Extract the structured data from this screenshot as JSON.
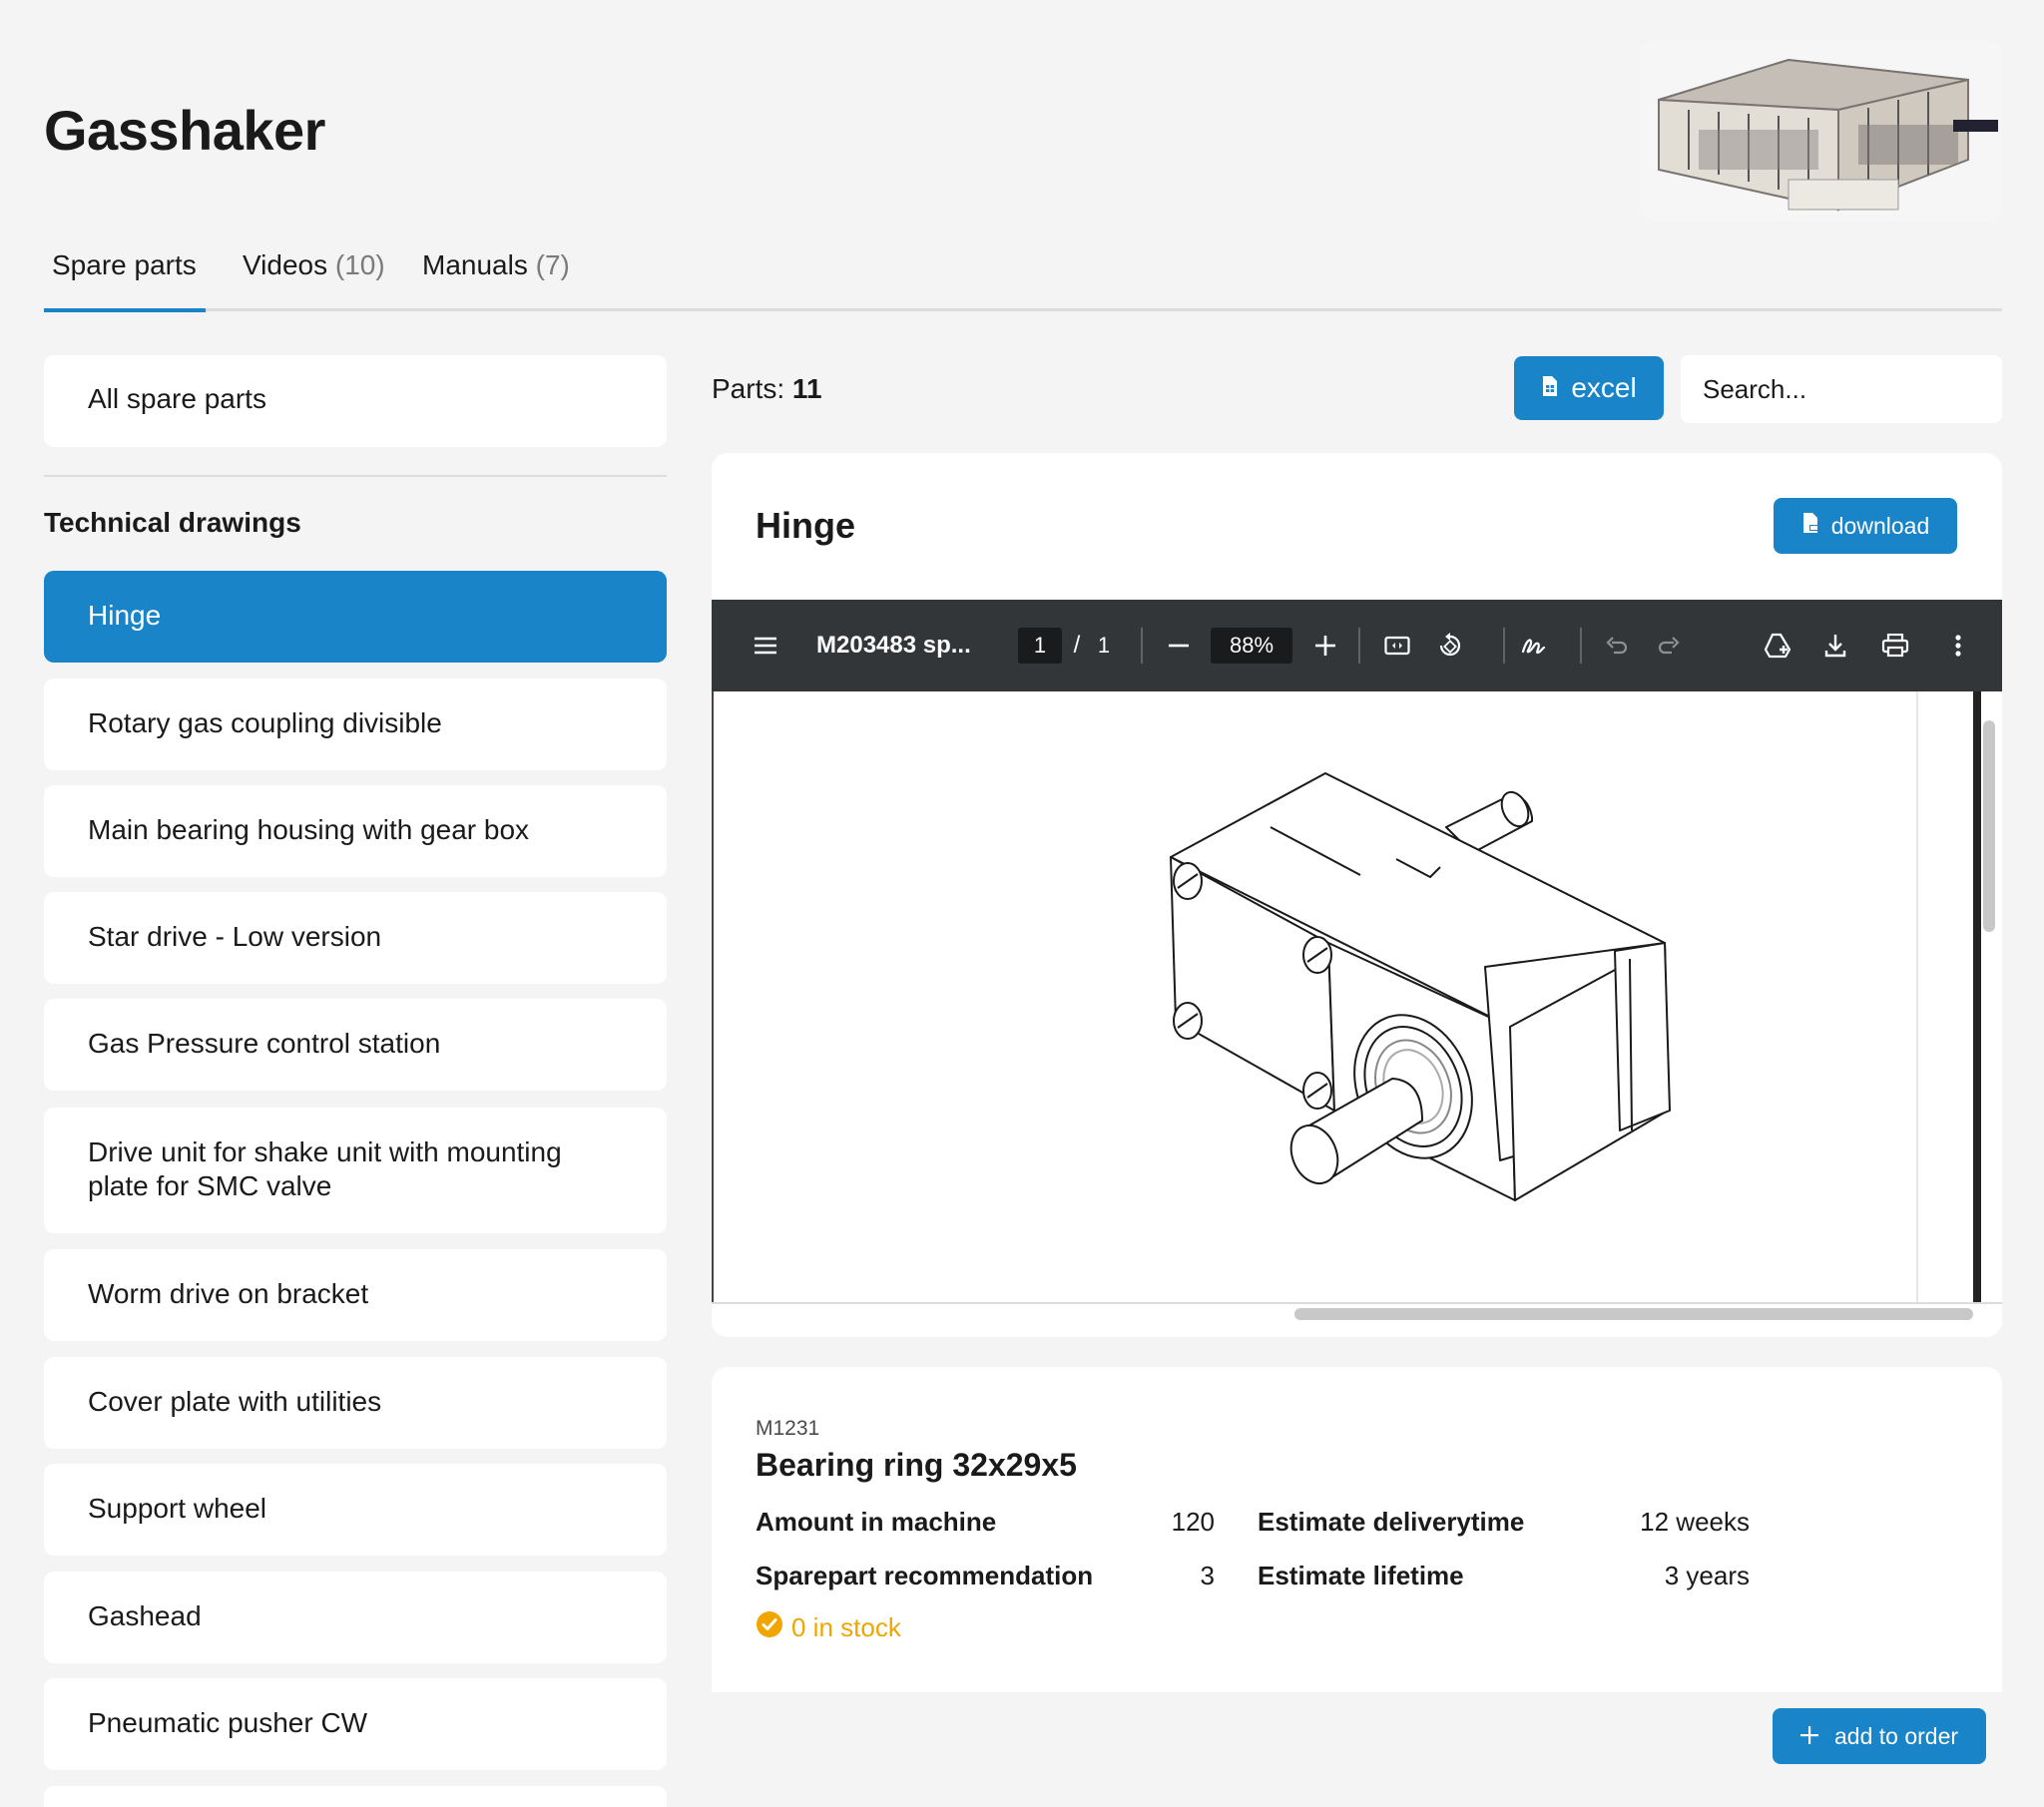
{
  "page": {
    "title": "Gasshaker"
  },
  "tabs": [
    {
      "label": "Spare parts",
      "count": ""
    },
    {
      "label": "Videos",
      "count": "(10)"
    },
    {
      "label": "Manuals",
      "count": "(7)"
    }
  ],
  "sidebar": {
    "all_label": "All spare parts",
    "section_title": "Technical drawings",
    "items": [
      {
        "label": "Hinge"
      },
      {
        "label": "Rotary gas coupling divisible"
      },
      {
        "label": "Main bearing housing with gear box"
      },
      {
        "label": "Star drive - Low version"
      },
      {
        "label": "Gas Pressure control station"
      },
      {
        "label": "Drive unit for shake unit with mounting plate for SMC valve"
      },
      {
        "label": "Worm drive on bracket"
      },
      {
        "label": "Cover plate with utilities"
      },
      {
        "label": "Support wheel"
      },
      {
        "label": "Gashead"
      },
      {
        "label": "Pneumatic pusher CW"
      }
    ]
  },
  "toolbar": {
    "parts_label": "Parts:",
    "parts_count": "11",
    "excel_label": "excel",
    "search_placeholder": "Search..."
  },
  "viewer": {
    "title": "Hinge",
    "download_label": "download",
    "pdf": {
      "filename": "M203483 sp...",
      "page": "1",
      "separator": "/",
      "total_pages": "1",
      "zoom": "88%"
    }
  },
  "part": {
    "number": "M1231",
    "name": "Bearing ring 32x29x5",
    "amount_label": "Amount in machine",
    "amount_value": "120",
    "recommendation_label": "Sparepart recommendation",
    "recommendation_value": "3",
    "delivery_label": "Estimate deliverytime",
    "delivery_value": "12 weeks",
    "lifetime_label": "Estimate lifetime",
    "lifetime_value": "3 years",
    "stock_label": "0 in stock",
    "add_label": "add to order"
  },
  "colors": {
    "accent": "#1a84c9",
    "warning": "#f0a500",
    "toolbar": "#323639"
  }
}
